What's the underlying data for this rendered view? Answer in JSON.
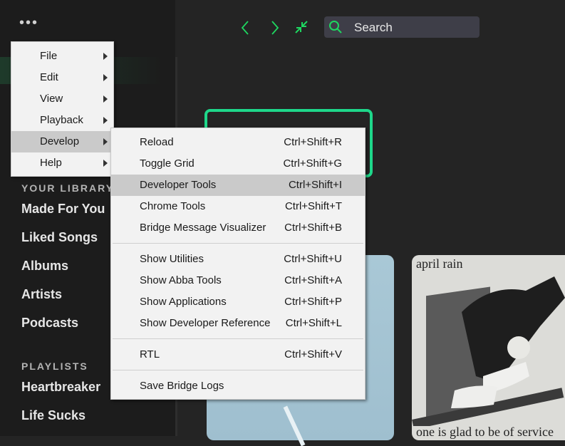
{
  "colors": {
    "background": "#242424",
    "sidebar": "#1c1c1c",
    "accent": "#1ed760",
    "focus_outline": "#1ed78a",
    "menu_bg": "#f2f2f2",
    "menu_highlight": "#cacaca"
  },
  "topbar": {
    "more_label": "•••",
    "search_placeholder": "Search",
    "icons": [
      "back-icon",
      "forward-icon",
      "collapse-icon",
      "search-icon"
    ]
  },
  "sidebar": {
    "library_heading": "YOUR LIBRARY",
    "library_items": [
      "Made For You",
      "Liked Songs",
      "Albums",
      "Artists",
      "Podcasts"
    ],
    "playlists_heading": "PLAYLISTS",
    "playlists": [
      "Heartbreaker",
      "Life Sucks"
    ]
  },
  "main_menu": {
    "items": [
      {
        "label": "File"
      },
      {
        "label": "Edit"
      },
      {
        "label": "View"
      },
      {
        "label": "Playback"
      },
      {
        "label": "Develop"
      },
      {
        "label": "Help"
      }
    ],
    "highlighted": "Develop"
  },
  "develop_menu": {
    "groups": [
      [
        {
          "label": "Reload",
          "shortcut": "Ctrl+Shift+R"
        },
        {
          "label": "Toggle Grid",
          "shortcut": "Ctrl+Shift+G"
        },
        {
          "label": "Developer Tools",
          "shortcut": "Ctrl+Shift+I"
        },
        {
          "label": "Chrome Tools",
          "shortcut": "Ctrl+Shift+T"
        },
        {
          "label": "Bridge Message Visualizer",
          "shortcut": "Ctrl+Shift+B"
        }
      ],
      [
        {
          "label": "Show Utilities",
          "shortcut": "Ctrl+Shift+U"
        },
        {
          "label": "Show Abba Tools",
          "shortcut": "Ctrl+Shift+A"
        },
        {
          "label": "Show Applications",
          "shortcut": "Ctrl+Shift+P"
        },
        {
          "label": "Show Developer Reference",
          "shortcut": "Ctrl+Shift+L"
        }
      ],
      [
        {
          "label": "RTL",
          "shortcut": "Ctrl+Shift+V"
        }
      ],
      [
        {
          "label": "Save Bridge Logs",
          "shortcut": ""
        }
      ]
    ],
    "highlighted": "Developer Tools"
  },
  "cards": [
    {
      "title": "",
      "caption": ""
    },
    {
      "title": "april rain",
      "caption": "one is glad to be of service"
    }
  ]
}
